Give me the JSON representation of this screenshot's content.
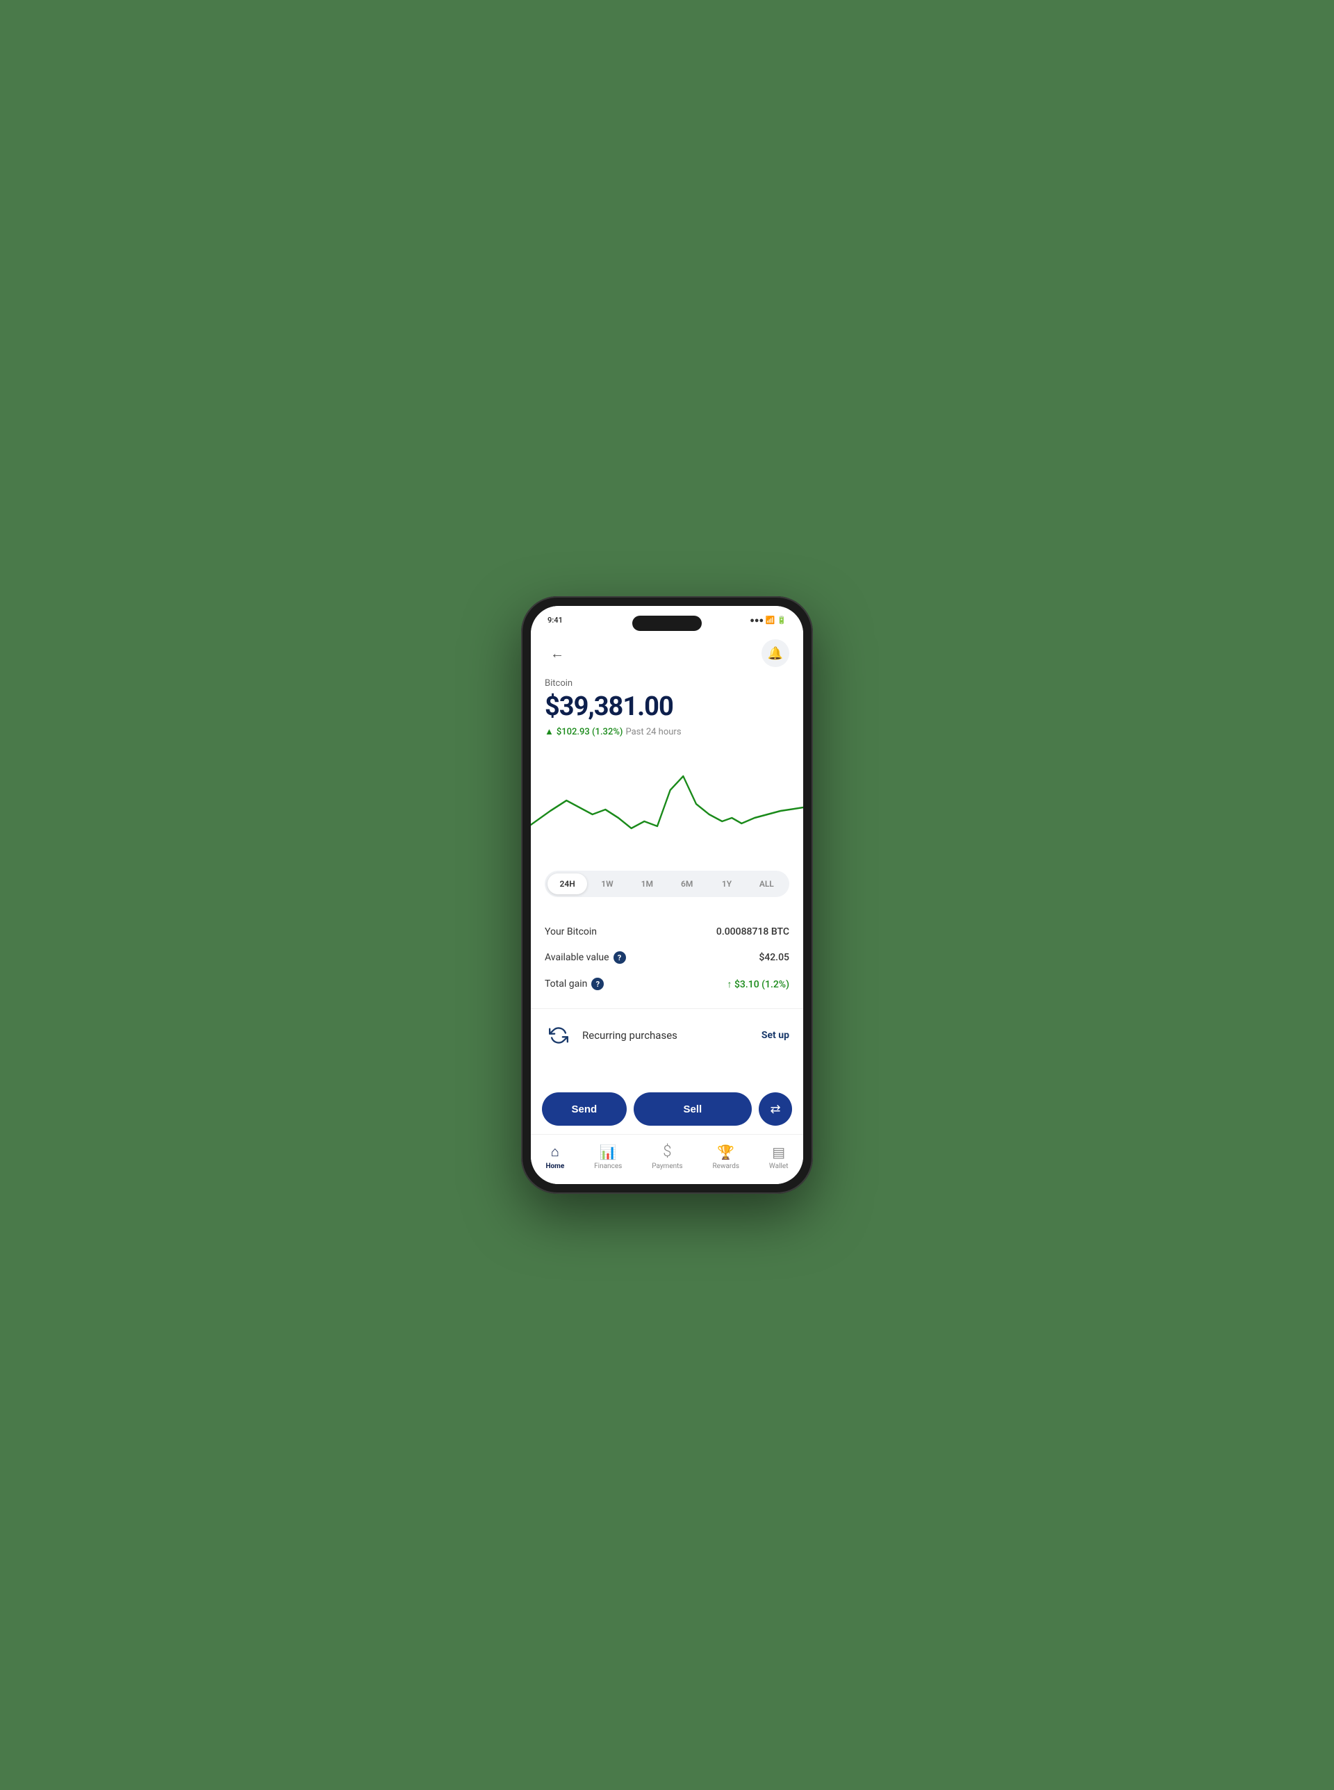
{
  "header": {
    "back_label": "←",
    "notification_label": "🔔"
  },
  "crypto": {
    "name": "Bitcoin",
    "price": "$39,381.00",
    "change_amount": "$102.93 (1.32%)",
    "change_period": "Past 24 hours",
    "up_arrow": "↑"
  },
  "chart": {
    "time_filters": [
      "24H",
      "1W",
      "1M",
      "6M",
      "1Y",
      "ALL"
    ],
    "active_filter": "24H"
  },
  "stats": {
    "your_bitcoin_label": "Your Bitcoin",
    "your_bitcoin_value": "0.00088718 BTC",
    "available_value_label": "Available value",
    "available_value": "$42.05",
    "total_gain_label": "Total gain",
    "total_gain_value": "↑ $3.10 (1.2%)"
  },
  "recurring": {
    "label": "Recurring purchases",
    "setup_label": "Set up"
  },
  "actions": {
    "send_label": "Send",
    "sell_label": "Sell",
    "swap_icon": "⇄"
  },
  "nav": {
    "items": [
      {
        "id": "home",
        "icon": "🏠",
        "label": "Home",
        "active": true
      },
      {
        "id": "finances",
        "icon": "📊",
        "label": "Finances",
        "active": false
      },
      {
        "id": "payments",
        "icon": "$",
        "label": "Payments",
        "active": false
      },
      {
        "id": "rewards",
        "icon": "🏆",
        "label": "Rewards",
        "active": false
      },
      {
        "id": "wallet",
        "icon": "▤",
        "label": "Wallet",
        "active": false
      }
    ]
  },
  "colors": {
    "primary": "#1a3a8f",
    "green": "#1a8a1a",
    "text_dark": "#0d1f4c"
  }
}
